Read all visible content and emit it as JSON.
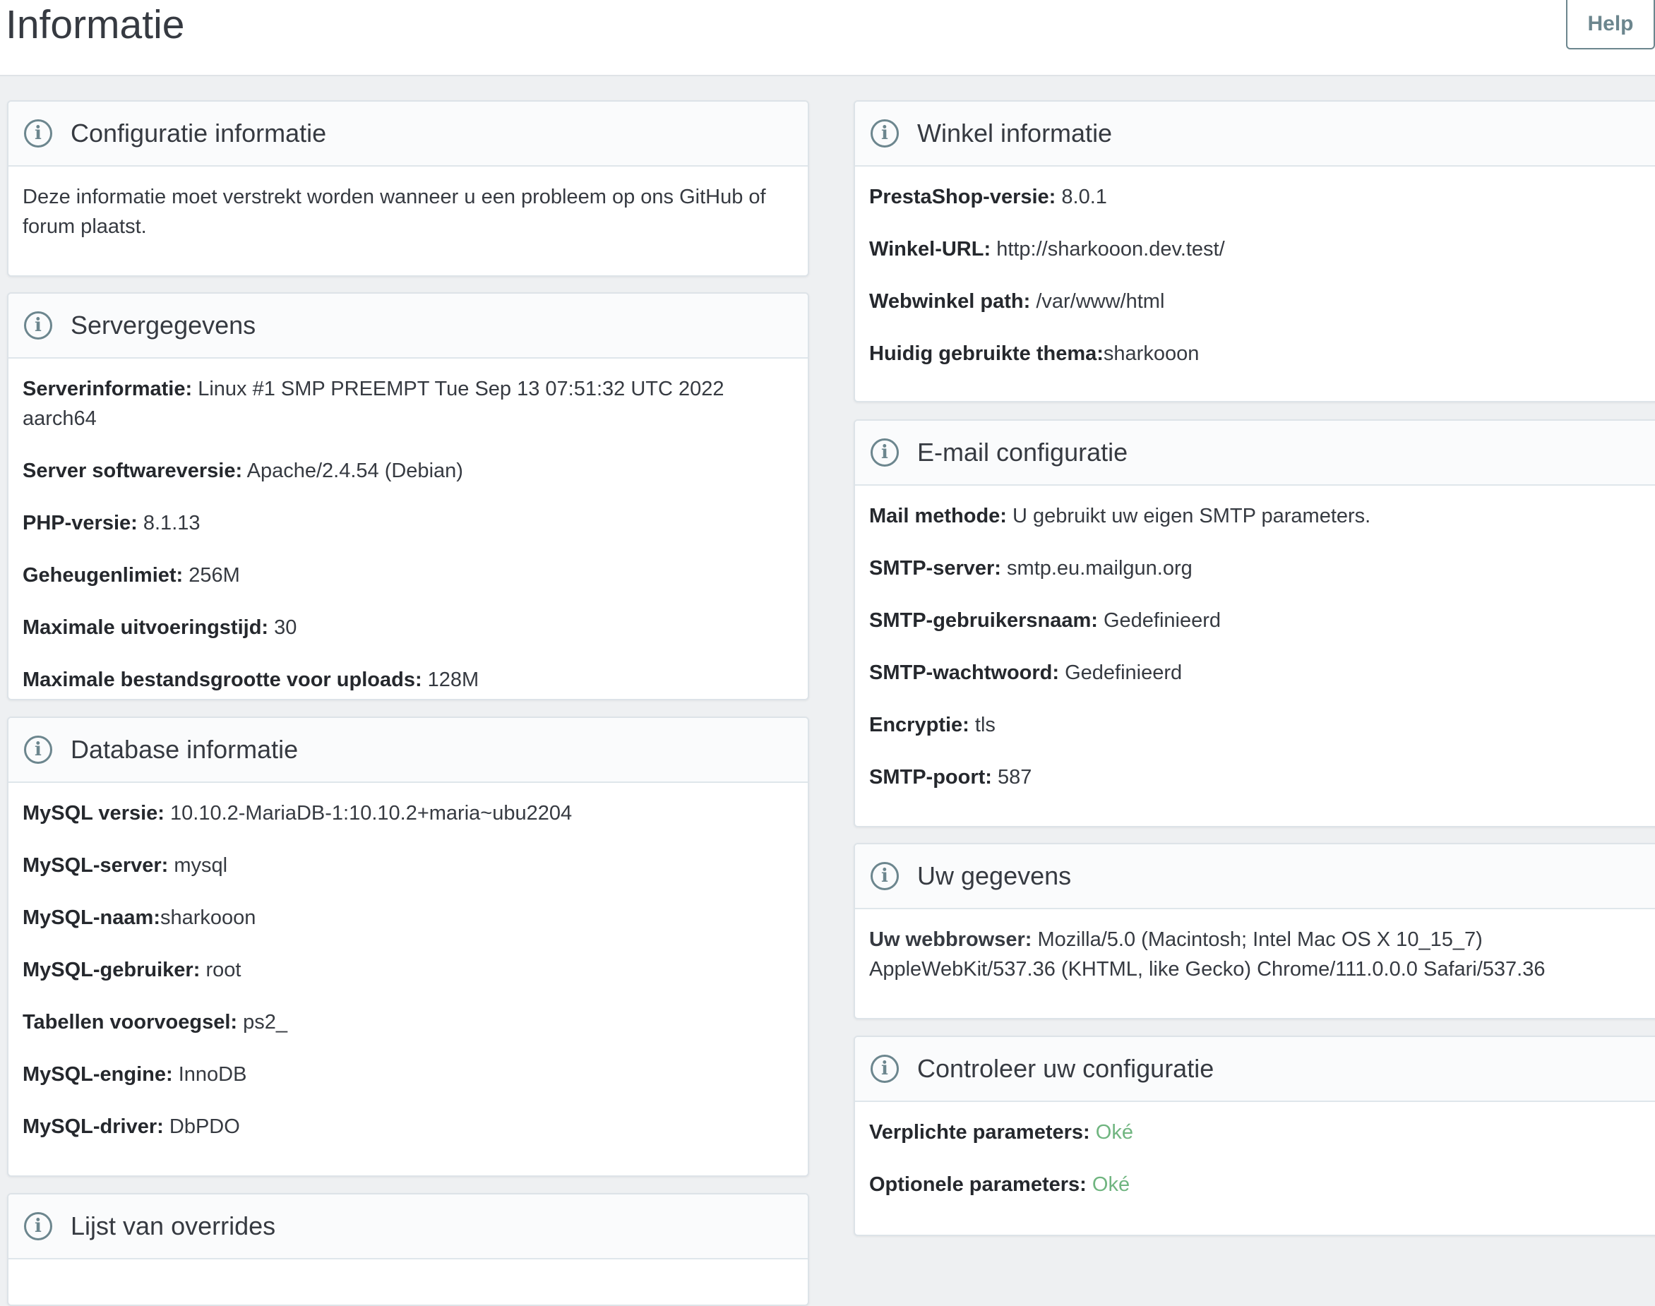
{
  "page": {
    "title": "Informatie",
    "help_label": "Help",
    "icon": "info-circle-icon",
    "ok_color": "#70b580"
  },
  "config": {
    "title": "Configuratie informatie",
    "description": "Deze informatie moet verstrekt worden wanneer u een probleem op ons GitHub of forum plaatst."
  },
  "server": {
    "title": "Servergegevens",
    "rows": [
      {
        "label": "Serverinformatie:",
        "value": "Linux #1 SMP PREEMPT Tue Sep 13 07:51:32 UTC 2022 aarch64"
      },
      {
        "label": "Server softwareversie:",
        "value": "Apache/2.4.54 (Debian)"
      },
      {
        "label": "PHP-versie:",
        "value": "8.1.13"
      },
      {
        "label": "Geheugenlimiet:",
        "value": "256M"
      },
      {
        "label": "Maximale uitvoeringstijd:",
        "value": "30"
      },
      {
        "label": "Maximale bestandsgrootte voor uploads:",
        "value": "128M"
      }
    ]
  },
  "database": {
    "title": "Database informatie",
    "rows": [
      {
        "label": "MySQL versie:",
        "value": "10.10.2-MariaDB-1:10.10.2+maria~ubu2204"
      },
      {
        "label": "MySQL-server:",
        "value": "mysql"
      },
      {
        "label": "MySQL-naam:",
        "value": "sharkooon"
      },
      {
        "label": "MySQL-gebruiker:",
        "value": "root"
      },
      {
        "label": "Tabellen voorvoegsel:",
        "value": "ps2_"
      },
      {
        "label": "MySQL-engine:",
        "value": "InnoDB"
      },
      {
        "label": "MySQL-driver:",
        "value": "DbPDO"
      }
    ]
  },
  "overrides": {
    "title": "Lijst van overrides"
  },
  "shop": {
    "title": "Winkel informatie",
    "rows": [
      {
        "label": "PrestaShop-versie:",
        "value": "8.0.1"
      },
      {
        "label": "Winkel-URL:",
        "value": "http://sharkooon.dev.test/"
      },
      {
        "label": "Webwinkel path:",
        "value": "/var/www/html"
      },
      {
        "label": "Huidig gebruikte thema:",
        "value": "sharkooon"
      }
    ]
  },
  "email": {
    "title": "E-mail configuratie",
    "rows": [
      {
        "label": "Mail methode:",
        "value": "U gebruikt uw eigen SMTP parameters."
      },
      {
        "label": "SMTP-server:",
        "value": "smtp.eu.mailgun.org"
      },
      {
        "label": "SMTP-gebruikersnaam:",
        "value": "Gedefinieerd"
      },
      {
        "label": "SMTP-wachtwoord:",
        "value": "Gedefinieerd"
      },
      {
        "label": "Encryptie:",
        "value": "tls"
      },
      {
        "label": "SMTP-poort:",
        "value": "587"
      }
    ]
  },
  "user": {
    "title": "Uw gegevens",
    "browser_label": "Uw webbrowser:",
    "browser_value": "Mozilla/5.0 (Macintosh; Intel Mac OS X 10_15_7) AppleWebKit/537.36 (KHTML, like Gecko) Chrome/111.0.0.0 Safari/537.36"
  },
  "check": {
    "title": "Controleer uw configuratie",
    "rows": [
      {
        "label": "Verplichte parameters:",
        "value": "Oké"
      },
      {
        "label": "Optionele parameters:",
        "value": "Oké"
      }
    ]
  }
}
